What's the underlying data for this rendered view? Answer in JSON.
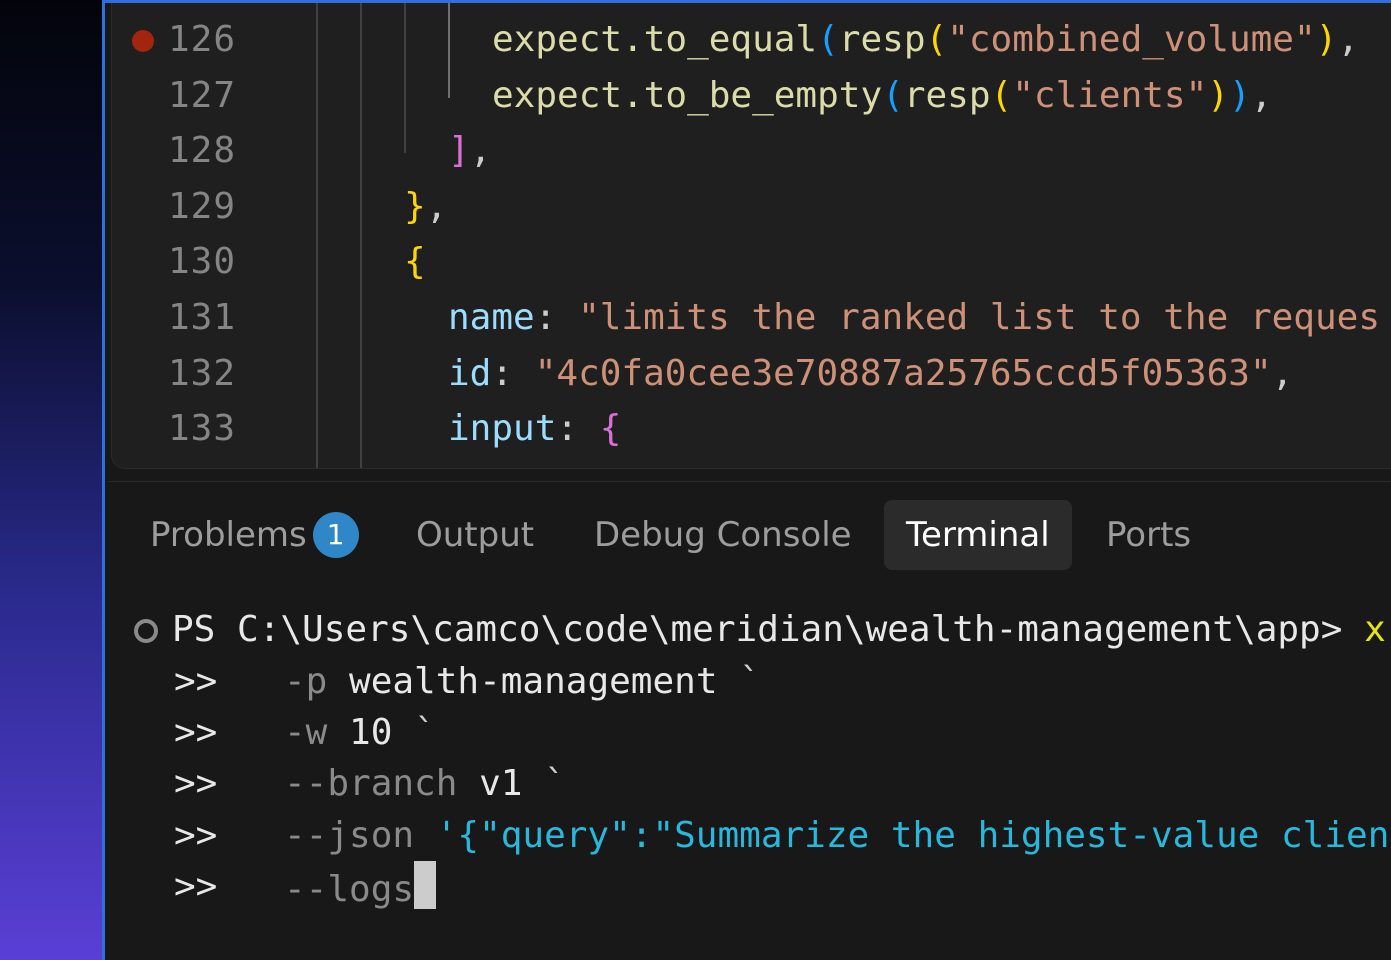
{
  "editor": {
    "lines": [
      {
        "num": "126",
        "breakpoint": true,
        "tokens": [
          [
            "c-fn",
            "expect.to_equal"
          ],
          [
            "c-b3",
            "("
          ],
          [
            "c-fn",
            "resp"
          ],
          [
            "c-b1",
            "("
          ],
          [
            "c-str",
            "\"combined_volume\""
          ],
          [
            "c-b1",
            ")"
          ],
          [
            "c-plain",
            ","
          ]
        ]
      },
      {
        "num": "127",
        "breakpoint": false,
        "tokens": [
          [
            "c-fn",
            "expect.to_be_empty"
          ],
          [
            "c-b3",
            "("
          ],
          [
            "c-fn",
            "resp"
          ],
          [
            "c-b1",
            "("
          ],
          [
            "c-str",
            "\"clients\""
          ],
          [
            "c-b1",
            ")"
          ],
          [
            "c-b3",
            ")"
          ],
          [
            "c-plain",
            ","
          ]
        ]
      },
      {
        "num": "128",
        "breakpoint": false,
        "tokens": [
          [
            "c-b2",
            "]"
          ],
          [
            "c-plain",
            ","
          ]
        ]
      },
      {
        "num": "129",
        "breakpoint": false,
        "tokens": [
          [
            "c-b1",
            "}"
          ],
          [
            "c-plain",
            ","
          ]
        ]
      },
      {
        "num": "130",
        "breakpoint": false,
        "tokens": [
          [
            "c-b1",
            "{"
          ]
        ]
      },
      {
        "num": "131",
        "breakpoint": false,
        "tokens": [
          [
            "c-key",
            "name"
          ],
          [
            "c-plain",
            ": "
          ],
          [
            "c-str",
            "\"limits the ranked list to the reques"
          ]
        ]
      },
      {
        "num": "132",
        "breakpoint": false,
        "tokens": [
          [
            "c-key",
            "id"
          ],
          [
            "c-plain",
            ": "
          ],
          [
            "c-str",
            "\"4c0fa0cee3e70887a25765ccd5f05363\""
          ],
          [
            "c-plain",
            ","
          ]
        ]
      },
      {
        "num": "133",
        "breakpoint": false,
        "tokens": [
          [
            "c-key",
            "input"
          ],
          [
            "c-plain",
            ": "
          ],
          [
            "c-b2",
            "{"
          ]
        ]
      }
    ]
  },
  "panel": {
    "tabs": [
      {
        "label": "Problems",
        "badge": "1",
        "active": false
      },
      {
        "label": "Output",
        "active": false
      },
      {
        "label": "Debug Console",
        "active": false
      },
      {
        "label": "Terminal",
        "active": true
      },
      {
        "label": "Ports",
        "active": false
      }
    ],
    "terminal": {
      "prompt": "PS C:\\Users\\camco\\code\\meridian\\wealth-management\\app> ",
      "command_start": "x",
      "continuation": ">>",
      "lines": [
        [
          [
            "t-dim",
            "-p "
          ],
          [
            "t-white",
            "wealth-management "
          ],
          [
            "t-plain",
            "`"
          ]
        ],
        [
          [
            "t-dim",
            "-w "
          ],
          [
            "t-white",
            "10 "
          ],
          [
            "t-plain",
            "`"
          ]
        ],
        [
          [
            "t-dim",
            "--branch "
          ],
          [
            "t-white",
            "v1 "
          ],
          [
            "t-plain",
            "`"
          ]
        ],
        [
          [
            "t-dim",
            "--json "
          ],
          [
            "t-cyan",
            "'{\"query\":\"Summarize the highest-value clien"
          ]
        ],
        [
          [
            "t-dim",
            "--logs"
          ]
        ]
      ]
    }
  }
}
